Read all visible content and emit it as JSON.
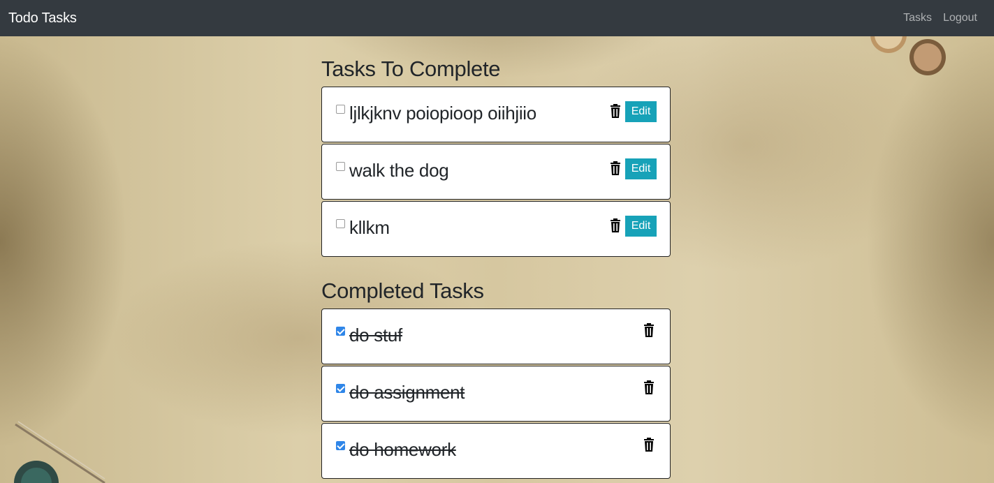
{
  "navbar": {
    "brand": "Todo Tasks",
    "links": [
      {
        "label": "Tasks"
      },
      {
        "label": "Logout"
      }
    ]
  },
  "sections": {
    "todo_title": "Tasks To Complete",
    "completed_title": "Completed Tasks"
  },
  "todo_tasks": [
    {
      "text": "ljlkjknv poiopioop oiihjiio",
      "checked": false,
      "edit_label": "Edit"
    },
    {
      "text": "walk the dog",
      "checked": false,
      "edit_label": "Edit"
    },
    {
      "text": "kllkm",
      "checked": false,
      "edit_label": "Edit"
    }
  ],
  "completed_tasks": [
    {
      "text": "do stuf",
      "checked": true
    },
    {
      "text": "do assignment",
      "checked": true
    },
    {
      "text": "do homework",
      "checked": true
    }
  ],
  "icons": {
    "delete": "trash-icon",
    "checkbox": "checkbox-icon"
  },
  "colors": {
    "navbar": "#343a40",
    "edit_button": "#17a2b8",
    "checkbox_checked": "#2f86e8"
  }
}
